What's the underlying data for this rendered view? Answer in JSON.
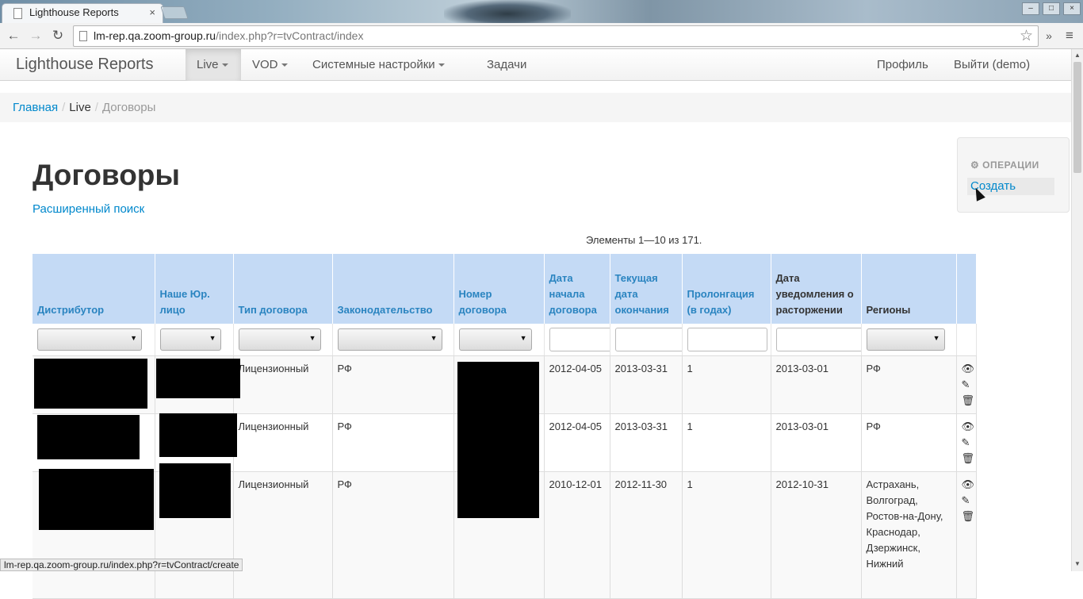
{
  "browser": {
    "tab_title": "Lighthouse Reports",
    "tab_close": "×",
    "url_host": "lm-rep.qa.zoom-group.ru",
    "url_path": "/index.php?r=tvContract/index",
    "status_url": "lm-rep.qa.zoom-group.ru/index.php?r=tvContract/create",
    "icons": [
      "back-arrow-icon",
      "forward-arrow-icon",
      "reload-icon",
      "bookmark-star-icon",
      "extensions-chevron-icon",
      "menu-icon"
    ]
  },
  "navbar": {
    "brand": "Lighthouse Reports",
    "items": [
      {
        "label": "Live",
        "dropdown": true,
        "active": true
      },
      {
        "label": "VOD",
        "dropdown": true
      },
      {
        "label": "Системные настройки",
        "dropdown": true
      },
      {
        "label": "Задачи"
      }
    ],
    "right": [
      "Профиль",
      "Выйти (demo)"
    ]
  },
  "breadcrumb": {
    "home": "Главная",
    "section": "Live",
    "current": "Договоры"
  },
  "page": {
    "title": "Договоры",
    "advanced_search": "Расширенный поиск",
    "summary": "Элементы 1—10 из 171."
  },
  "operations": {
    "heading": "ОПЕРАЦИИ",
    "create": "Создать"
  },
  "table": {
    "headers": [
      "Дистрибутор",
      "Наше Юр. лицо",
      "Тип договора",
      "Законодательство",
      "Номер договора",
      "Дата начала договора",
      "Текущая дата окончания",
      "Пролонгация (в годах)",
      "Дата уведомления о расторжении",
      "Регионы",
      ""
    ],
    "rows": [
      {
        "type": "Лицензионный",
        "law": "РФ",
        "start": "2012-04-05",
        "end": "2013-03-31",
        "prolong": "1",
        "notice": "2013-03-01",
        "regions": "РФ"
      },
      {
        "type": "Лицензионный",
        "law": "РФ",
        "start": "2012-04-05",
        "end": "2013-03-31",
        "prolong": "1",
        "notice": "2013-03-01",
        "regions": "РФ"
      },
      {
        "type": "Лицензионный",
        "law": "РФ",
        "start": "2010-12-01",
        "end": "2012-11-30",
        "prolong": "1",
        "notice": "2012-10-31",
        "regions": "Астрахань, Волгоград, Ростов-на-Дону, Краснодар, Дзержинск, Нижний"
      }
    ],
    "action_icons": [
      "view-eye-icon",
      "edit-pencil-icon",
      "delete-trash-icon"
    ]
  },
  "colors": {
    "link": "#0088cc",
    "header_bg": "#c4daf5"
  }
}
